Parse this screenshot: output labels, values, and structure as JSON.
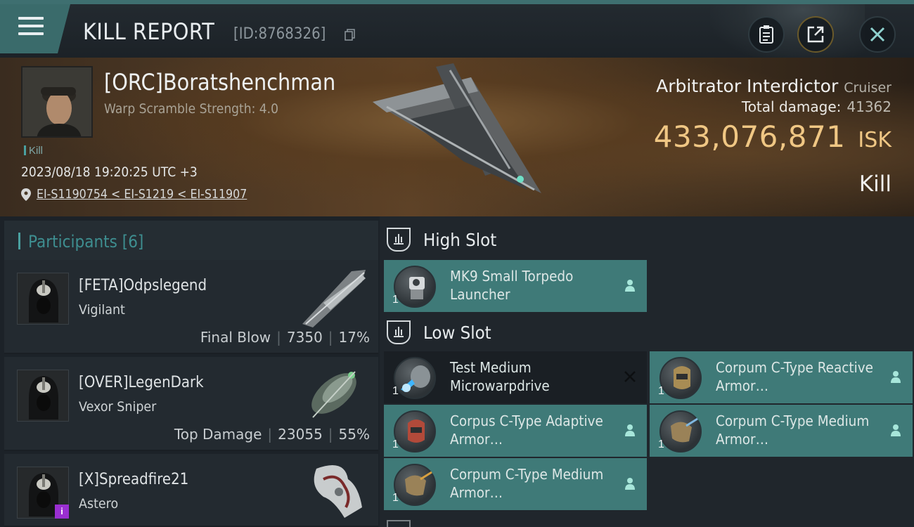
{
  "header": {
    "title": "KILL REPORT",
    "report_id": "[ID:8768326]",
    "menu_icon": "hamburger-menu-icon",
    "buttons": [
      "clipboard-icon",
      "share-icon",
      "close-icon"
    ]
  },
  "victim": {
    "name": "[ORC]Boratshenchman",
    "warp_scramble": "Warp Scramble Strength: 4.0",
    "tag": "Kill",
    "datetime": "2023/08/18 19:20:25 UTC +3",
    "location": "EI-S1190754 < EI-S1219 < EI-S11907",
    "ship_name": "Arbitrator Interdictor",
    "ship_class": "Cruiser",
    "total_damage_label": "Total damage:",
    "total_damage": "41362",
    "isk_value": "433,076,871",
    "isk_unit": "ISK",
    "result": "Kill"
  },
  "participants": {
    "title": "Participants",
    "count": "[6]",
    "items": [
      {
        "name": "[FETA]Odpslegend",
        "ship": "Vigilant",
        "role": "Final Blow",
        "damage": "7350",
        "percent": "17%"
      },
      {
        "name": "[OVER]LegenDark",
        "ship": "Vexor Sniper",
        "role": "Top Damage",
        "damage": "23055",
        "percent": "55%"
      },
      {
        "name": "[X]Spreadfire21",
        "ship": "Astero",
        "badge": "i"
      }
    ]
  },
  "slots": {
    "high": {
      "title": "High Slot",
      "modules": [
        {
          "qty": "1",
          "name": "MK9 Small Torpedo Launcher"
        }
      ]
    },
    "low": {
      "title": "Low Slot",
      "modules": [
        {
          "qty": "1",
          "name": "Test Medium Microwarpdrive"
        },
        {
          "qty": "1",
          "name": "Corpum C-Type Reactive Armor…"
        },
        {
          "qty": "1",
          "name": "Corpus C-Type Adaptive Armor…"
        },
        {
          "qty": "1",
          "name": "Corpum C-Type Medium Armor…"
        },
        {
          "qty": "1",
          "name": "Corpum C-Type Medium Armor…"
        }
      ]
    }
  },
  "colors": {
    "accent_teal": "#3f7a78",
    "isk_gold": "#f0c784",
    "badge_purple": "#9a2fd1"
  }
}
